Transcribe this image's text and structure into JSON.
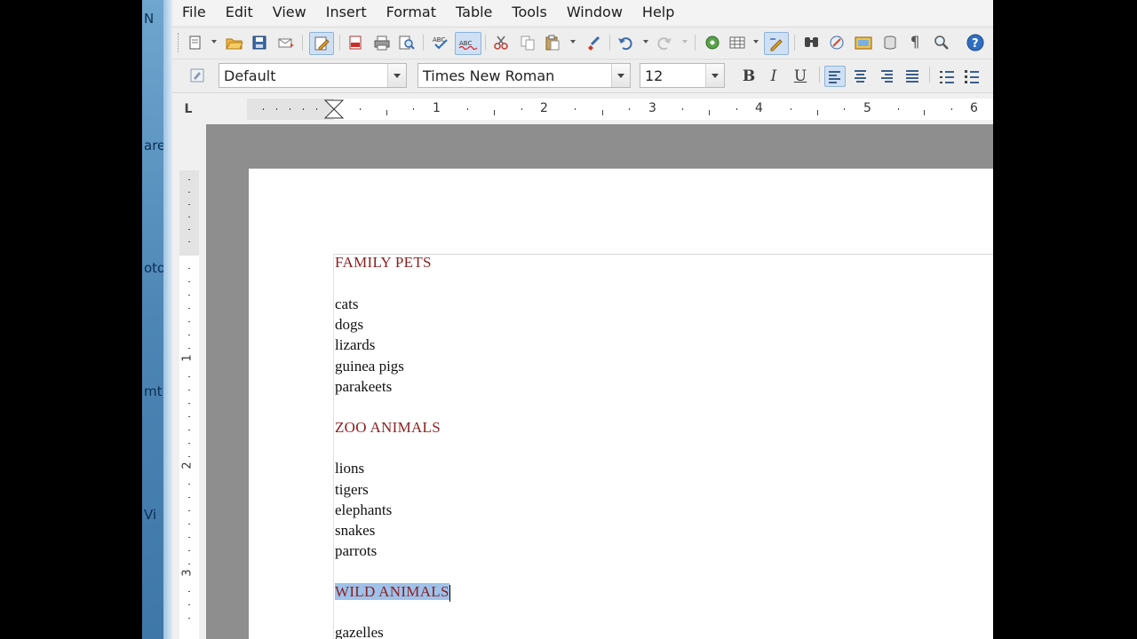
{
  "background_window": {
    "peek_texts": [
      "N",
      "are",
      "oto",
      "mt",
      "Vi"
    ]
  },
  "menu": {
    "items": [
      "File",
      "Edit",
      "View",
      "Insert",
      "Format",
      "Table",
      "Tools",
      "Window",
      "Help"
    ]
  },
  "standard_toolbar": {
    "icons": [
      "new-icon",
      "open-icon",
      "save-icon",
      "email-icon",
      "edit-mode-icon",
      "export-pdf-icon",
      "print-icon",
      "print-preview-icon",
      "spellcheck-icon",
      "autospellcheck-icon",
      "cut-icon",
      "copy-icon",
      "paste-icon",
      "format-paintbrush-icon",
      "undo-icon",
      "redo-icon",
      "navigator-icon",
      "table-icon",
      "show-draw-functions-icon",
      "find-replace-icon",
      "hyperlink-icon",
      "gallery-icon",
      "data-sources-icon",
      "nonprinting-characters-icon",
      "zoom-icon",
      "help-icon"
    ]
  },
  "formatting_toolbar": {
    "style": "Default",
    "font": "Times New Roman",
    "size": "12",
    "bold": "B",
    "italic": "I",
    "underline": "U"
  },
  "ruler": {
    "tab_type": "L",
    "numbers": [
      "1",
      "2",
      "3",
      "4",
      "5",
      "6"
    ],
    "vertical_numbers": [
      "1",
      "2",
      "3"
    ]
  },
  "document": {
    "lines": [
      {
        "text": "FAMILY PETS",
        "heading": true
      },
      {
        "text": "",
        "heading": false
      },
      {
        "text": "cats",
        "heading": false
      },
      {
        "text": "dogs",
        "heading": false
      },
      {
        "text": "lizards",
        "heading": false
      },
      {
        "text": "guinea pigs",
        "heading": false
      },
      {
        "text": "parakeets",
        "heading": false
      },
      {
        "text": "",
        "heading": false
      },
      {
        "text": "ZOO ANIMALS",
        "heading": true
      },
      {
        "text": "",
        "heading": false
      },
      {
        "text": "lions",
        "heading": false
      },
      {
        "text": "tigers",
        "heading": false
      },
      {
        "text": "elephants",
        "heading": false
      },
      {
        "text": "snakes",
        "heading": false
      },
      {
        "text": "parrots",
        "heading": false
      },
      {
        "text": "",
        "heading": false
      },
      {
        "text": "WILD ANIMALS",
        "heading": true,
        "selected": true
      },
      {
        "text": "",
        "heading": false
      },
      {
        "text": "gazelles",
        "heading": false
      }
    ],
    "heading_color": "#8b1e1e",
    "selection_color": "#9ec2ea"
  }
}
